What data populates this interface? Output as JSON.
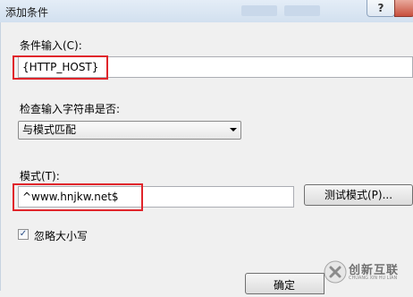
{
  "window": {
    "title": "添加条件",
    "help_label": "?"
  },
  "form": {
    "condition_input_label": "条件输入(C):",
    "condition_input_value": "{HTTP_HOST}",
    "check_label": "检查输入字符串是否:",
    "check_selected": "与模式匹配",
    "pattern_label": "模式(T):",
    "pattern_value": "^www.hnjkw.net$",
    "test_button": "测试模式(P)...",
    "ignore_case_label": "忽略大小写",
    "ignore_case_checked": true,
    "ok_button": "确定"
  },
  "highlight_color": "#e0252b",
  "watermark": {
    "text": "创新互联",
    "sub": "CHUANG XIN HU LIAN"
  }
}
